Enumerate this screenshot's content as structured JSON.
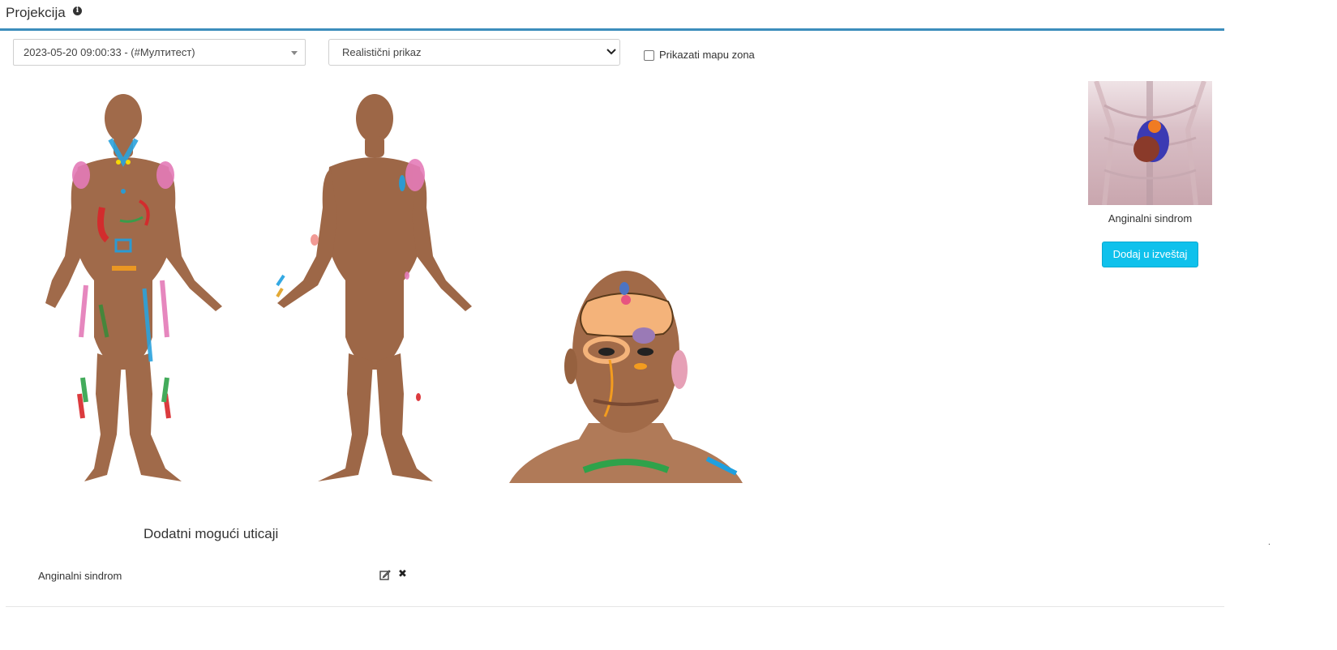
{
  "header": {
    "title": "Projekcija",
    "info_icon": "info-circle-icon"
  },
  "controls": {
    "session_select": {
      "value": "2023-05-20 09:00:33 - (#Мултитест)"
    },
    "view_select": {
      "value": "Realistični prikaz"
    },
    "zone_map_checkbox": {
      "label": "Prikazati mapu zona",
      "checked": false
    }
  },
  "figures": [
    "body-front",
    "body-back",
    "head-front"
  ],
  "side_panel": {
    "syndrome_caption": "Anginalni sindrom",
    "add_button": "Dodaj u izveštaj"
  },
  "additional": {
    "title": "Dodatni mogući uticaji",
    "rows": [
      {
        "label": "Anginalni sindrom",
        "actions": [
          "edit-icon",
          "remove-icon"
        ]
      }
    ]
  },
  "colors": {
    "accent": "#3c8dbc",
    "button": "#0fc1ec",
    "skin": "#a06a4a"
  }
}
